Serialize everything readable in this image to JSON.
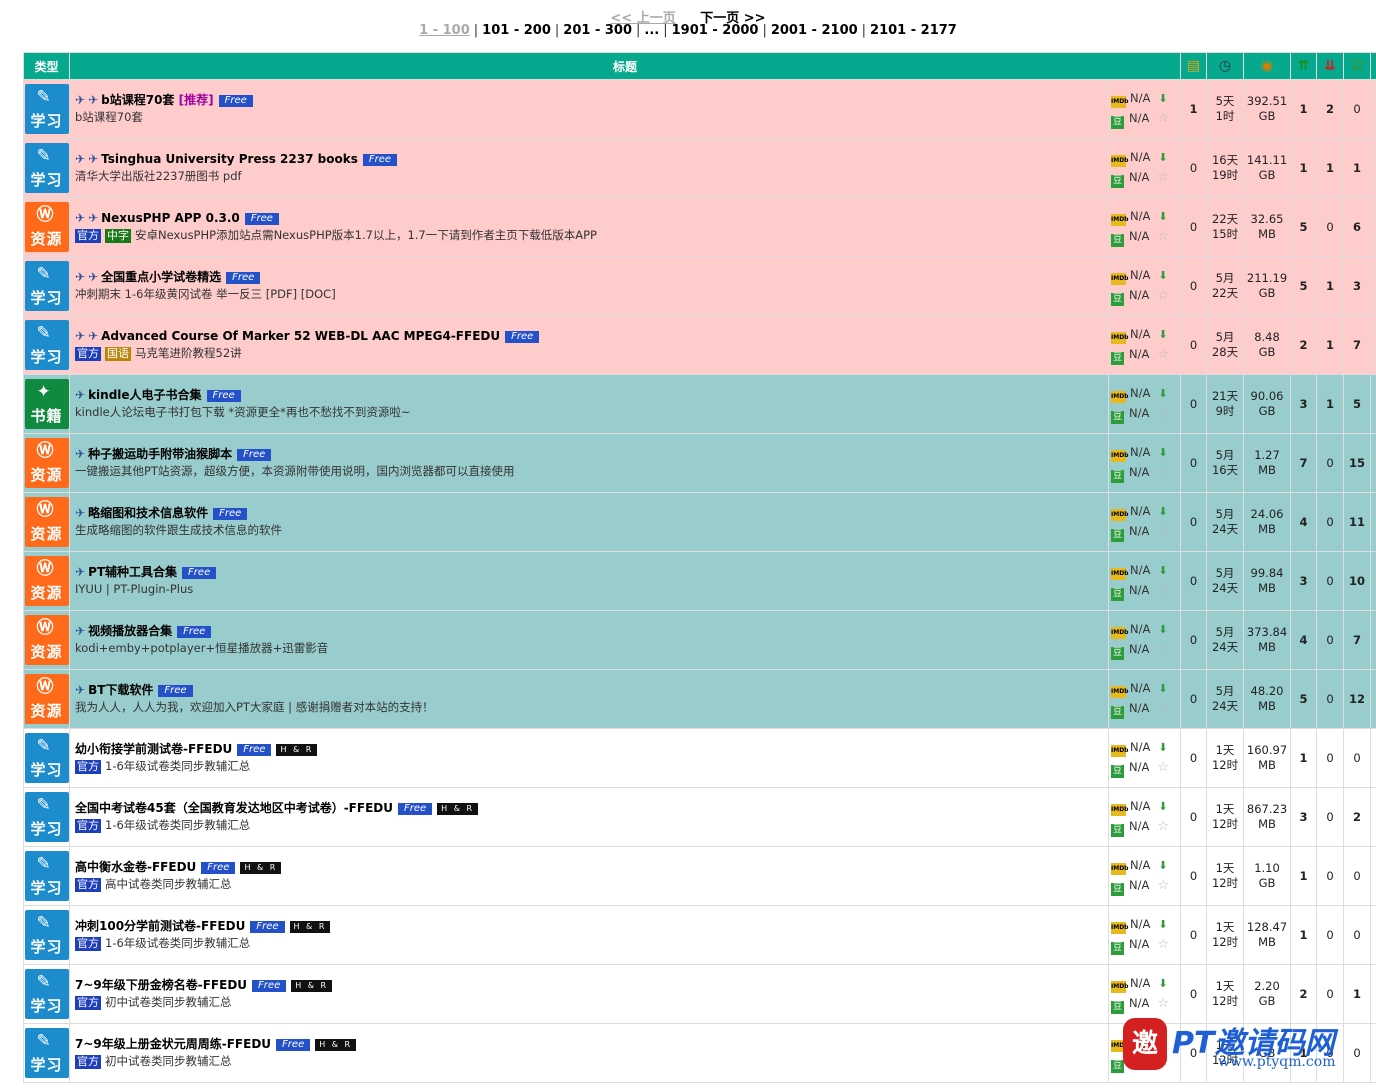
{
  "pager": {
    "prev_label": "<< 上一页",
    "next_label": "下一页 >>",
    "pages": [
      "1 - 100",
      "101 - 200",
      "201 - 300",
      "...",
      "1901 - 2000",
      "2001 - 2100",
      "2101 - 2177"
    ],
    "separator": "|"
  },
  "header": {
    "type": "类型",
    "title": "标题"
  },
  "rating_na": "N/A",
  "rows": [
    {
      "kind": "sticky",
      "cat": "学习",
      "catclass": "study",
      "pins": 2,
      "title": "b站课程70套",
      "recommend": "[推荐]",
      "free": "Free",
      "hr": "",
      "labels": [],
      "subtitle": "b站课程70套",
      "comments": "1",
      "time": [
        "5天",
        "1时"
      ],
      "size": [
        "392.51",
        "GB"
      ],
      "seeders": "1",
      "leechers": "2",
      "completed": "0"
    },
    {
      "kind": "sticky",
      "cat": "学习",
      "catclass": "study",
      "pins": 2,
      "title": "Tsinghua University Press 2237 books",
      "recommend": "",
      "free": "Free",
      "hr": "",
      "labels": [],
      "subtitle": "清华大学出版社2237册图书 pdf",
      "comments": "0",
      "time": [
        "16天",
        "19时"
      ],
      "size": [
        "141.11",
        "GB"
      ],
      "seeders": "1",
      "leechers": "1",
      "completed": "1"
    },
    {
      "kind": "sticky",
      "cat": "资源",
      "catclass": "res",
      "pins": 2,
      "title": "NexusPHP APP 0.3.0",
      "recommend": "",
      "free": "Free",
      "hr": "",
      "labels": [
        {
          "text": "官方",
          "color": "blue"
        },
        {
          "text": "中字",
          "color": "green"
        }
      ],
      "subtitle": "安卓NexusPHP添加站点需NexusPHP版本1.7以上，1.7一下请到作者主页下载低版本APP",
      "comments": "0",
      "time": [
        "22天",
        "15时"
      ],
      "size": [
        "32.65",
        "MB"
      ],
      "seeders": "5",
      "leechers": "0",
      "completed": "6"
    },
    {
      "kind": "sticky",
      "cat": "学习",
      "catclass": "study",
      "pins": 2,
      "title": "全国重点小学试卷精选",
      "recommend": "",
      "free": "Free",
      "hr": "",
      "labels": [],
      "subtitle": "冲刺期末 1-6年级黄冈试卷 举一反三 [PDF] [DOC]",
      "comments": "0",
      "time": [
        "5月",
        "22天"
      ],
      "size": [
        "211.19",
        "GB"
      ],
      "seeders": "5",
      "leechers": "1",
      "completed": "3"
    },
    {
      "kind": "sticky",
      "cat": "学习",
      "catclass": "study",
      "pins": 2,
      "title": "Advanced Course Of Marker 52 WEB-DL AAC MPEG4-FFEDU",
      "recommend": "",
      "free": "Free",
      "hr": "",
      "labels": [
        {
          "text": "官方",
          "color": "blue"
        },
        {
          "text": "国语",
          "color": "gold"
        }
      ],
      "subtitle": "马克笔进阶教程52讲",
      "comments": "0",
      "time": [
        "5月",
        "28天"
      ],
      "size": [
        "8.48",
        "GB"
      ],
      "seeders": "2",
      "leechers": "1",
      "completed": "7"
    },
    {
      "kind": "promo",
      "cat": "书籍",
      "catclass": "book",
      "pins": 1,
      "title": "kindle人电子书合集",
      "recommend": "",
      "free": "Free",
      "hr": "",
      "labels": [],
      "subtitle": "kindle人论坛电子书打包下载 *资源更全*再也不愁找不到资源啦~",
      "comments": "0",
      "time": [
        "21天",
        "9时"
      ],
      "size": [
        "90.06",
        "GB"
      ],
      "seeders": "3",
      "leechers": "1",
      "completed": "5"
    },
    {
      "kind": "promo",
      "cat": "资源",
      "catclass": "res",
      "pins": 1,
      "title": "种子搬运助手附带油猴脚本",
      "recommend": "",
      "free": "Free",
      "hr": "",
      "labels": [],
      "subtitle": "一键搬运其他PT站资源，超级方便，本资源附带使用说明，国内浏览器都可以直接使用",
      "comments": "0",
      "time": [
        "5月",
        "16天"
      ],
      "size": [
        "1.27",
        "MB"
      ],
      "seeders": "7",
      "leechers": "0",
      "completed": "15"
    },
    {
      "kind": "promo",
      "cat": "资源",
      "catclass": "res",
      "pins": 1,
      "title": "略缩图和技术信息软件",
      "recommend": "",
      "free": "Free",
      "hr": "",
      "labels": [],
      "subtitle": "生成略缩图的软件跟生成技术信息的软件",
      "comments": "0",
      "time": [
        "5月",
        "24天"
      ],
      "size": [
        "24.06",
        "MB"
      ],
      "seeders": "4",
      "leechers": "0",
      "completed": "11"
    },
    {
      "kind": "promo",
      "cat": "资源",
      "catclass": "res",
      "pins": 1,
      "title": "PT辅种工具合集",
      "recommend": "",
      "free": "Free",
      "hr": "",
      "labels": [],
      "subtitle": "IYUU | PT-Plugin-Plus",
      "comments": "0",
      "time": [
        "5月",
        "24天"
      ],
      "size": [
        "99.84",
        "MB"
      ],
      "seeders": "3",
      "leechers": "0",
      "completed": "10"
    },
    {
      "kind": "promo",
      "cat": "资源",
      "catclass": "res",
      "pins": 1,
      "title": "视频播放器合集",
      "recommend": "",
      "free": "Free",
      "hr": "",
      "labels": [],
      "subtitle": "kodi+emby+potplayer+恒星播放器+迅雷影音",
      "comments": "0",
      "time": [
        "5月",
        "24天"
      ],
      "size": [
        "373.84",
        "MB"
      ],
      "seeders": "4",
      "leechers": "0",
      "completed": "7"
    },
    {
      "kind": "promo",
      "cat": "资源",
      "catclass": "res",
      "pins": 1,
      "title": "BT下载软件",
      "recommend": "",
      "free": "Free",
      "hr": "",
      "labels": [],
      "subtitle": "我为人人，人人为我，欢迎加入PT大家庭 | 感谢捐赠者对本站的支持！",
      "comments": "0",
      "time": [
        "5月",
        "24天"
      ],
      "size": [
        "48.20",
        "MB"
      ],
      "seeders": "5",
      "leechers": "0",
      "completed": "12"
    },
    {
      "kind": "normal",
      "cat": "学习",
      "catclass": "study",
      "pins": 0,
      "title": "幼小衔接学前测试卷-FFEDU",
      "recommend": "",
      "free": "Free",
      "hr": "H & R",
      "labels": [
        {
          "text": "官方",
          "color": "blue"
        }
      ],
      "subtitle": "1-6年级试卷类同步教辅汇总",
      "comments": "0",
      "time": [
        "1天",
        "12时"
      ],
      "size": [
        "160.97",
        "MB"
      ],
      "seeders": "1",
      "leechers": "0",
      "completed": "0"
    },
    {
      "kind": "normal",
      "cat": "学习",
      "catclass": "study",
      "pins": 0,
      "title": "全国中考试卷45套（全国教育发达地区中考试卷）-FFEDU",
      "recommend": "",
      "free": "Free",
      "hr": "H & R",
      "labels": [
        {
          "text": "官方",
          "color": "blue"
        }
      ],
      "subtitle": "1-6年级试卷类同步教辅汇总",
      "comments": "0",
      "time": [
        "1天",
        "12时"
      ],
      "size": [
        "867.23",
        "MB"
      ],
      "seeders": "3",
      "leechers": "0",
      "completed": "2"
    },
    {
      "kind": "normal",
      "cat": "学习",
      "catclass": "study",
      "pins": 0,
      "title": "高中衡水金卷-FFEDU",
      "recommend": "",
      "free": "Free",
      "hr": "H & R",
      "labels": [
        {
          "text": "官方",
          "color": "blue"
        }
      ],
      "subtitle": "高中试卷类同步教辅汇总",
      "comments": "0",
      "time": [
        "1天",
        "12时"
      ],
      "size": [
        "1.10",
        "GB"
      ],
      "seeders": "1",
      "leechers": "0",
      "completed": "0"
    },
    {
      "kind": "normal",
      "cat": "学习",
      "catclass": "study",
      "pins": 0,
      "title": "冲刺100分学前测试卷-FFEDU",
      "recommend": "",
      "free": "Free",
      "hr": "H & R",
      "labels": [
        {
          "text": "官方",
          "color": "blue"
        }
      ],
      "subtitle": "1-6年级试卷类同步教辅汇总",
      "comments": "0",
      "time": [
        "1天",
        "12时"
      ],
      "size": [
        "128.47",
        "MB"
      ],
      "seeders": "1",
      "leechers": "0",
      "completed": "0"
    },
    {
      "kind": "normal",
      "cat": "学习",
      "catclass": "study",
      "pins": 0,
      "title": "7~9年级下册金榜名卷-FFEDU",
      "recommend": "",
      "free": "Free",
      "hr": "H & R",
      "labels": [
        {
          "text": "官方",
          "color": "blue"
        }
      ],
      "subtitle": "初中试卷类同步教辅汇总",
      "comments": "0",
      "time": [
        "1天",
        "12时"
      ],
      "size": [
        "2.20",
        "GB"
      ],
      "seeders": "2",
      "leechers": "0",
      "completed": "1"
    },
    {
      "kind": "normal",
      "cat": "学习",
      "catclass": "study",
      "pins": 0,
      "title": "7~9年级上册金状元周周练-FFEDU",
      "recommend": "",
      "free": "Free",
      "hr": "H & R",
      "labels": [
        {
          "text": "官方",
          "color": "blue"
        }
      ],
      "subtitle": "初中试卷类同步教辅汇总",
      "comments": "0",
      "time": [
        "1天",
        "12时"
      ],
      "size": [
        "",
        "GB"
      ],
      "seeders": "1",
      "leechers": "0",
      "completed": "0"
    }
  ],
  "watermark": {
    "logo": "邀",
    "text": "PT邀请码网",
    "url": "www.ptyqm.com"
  }
}
